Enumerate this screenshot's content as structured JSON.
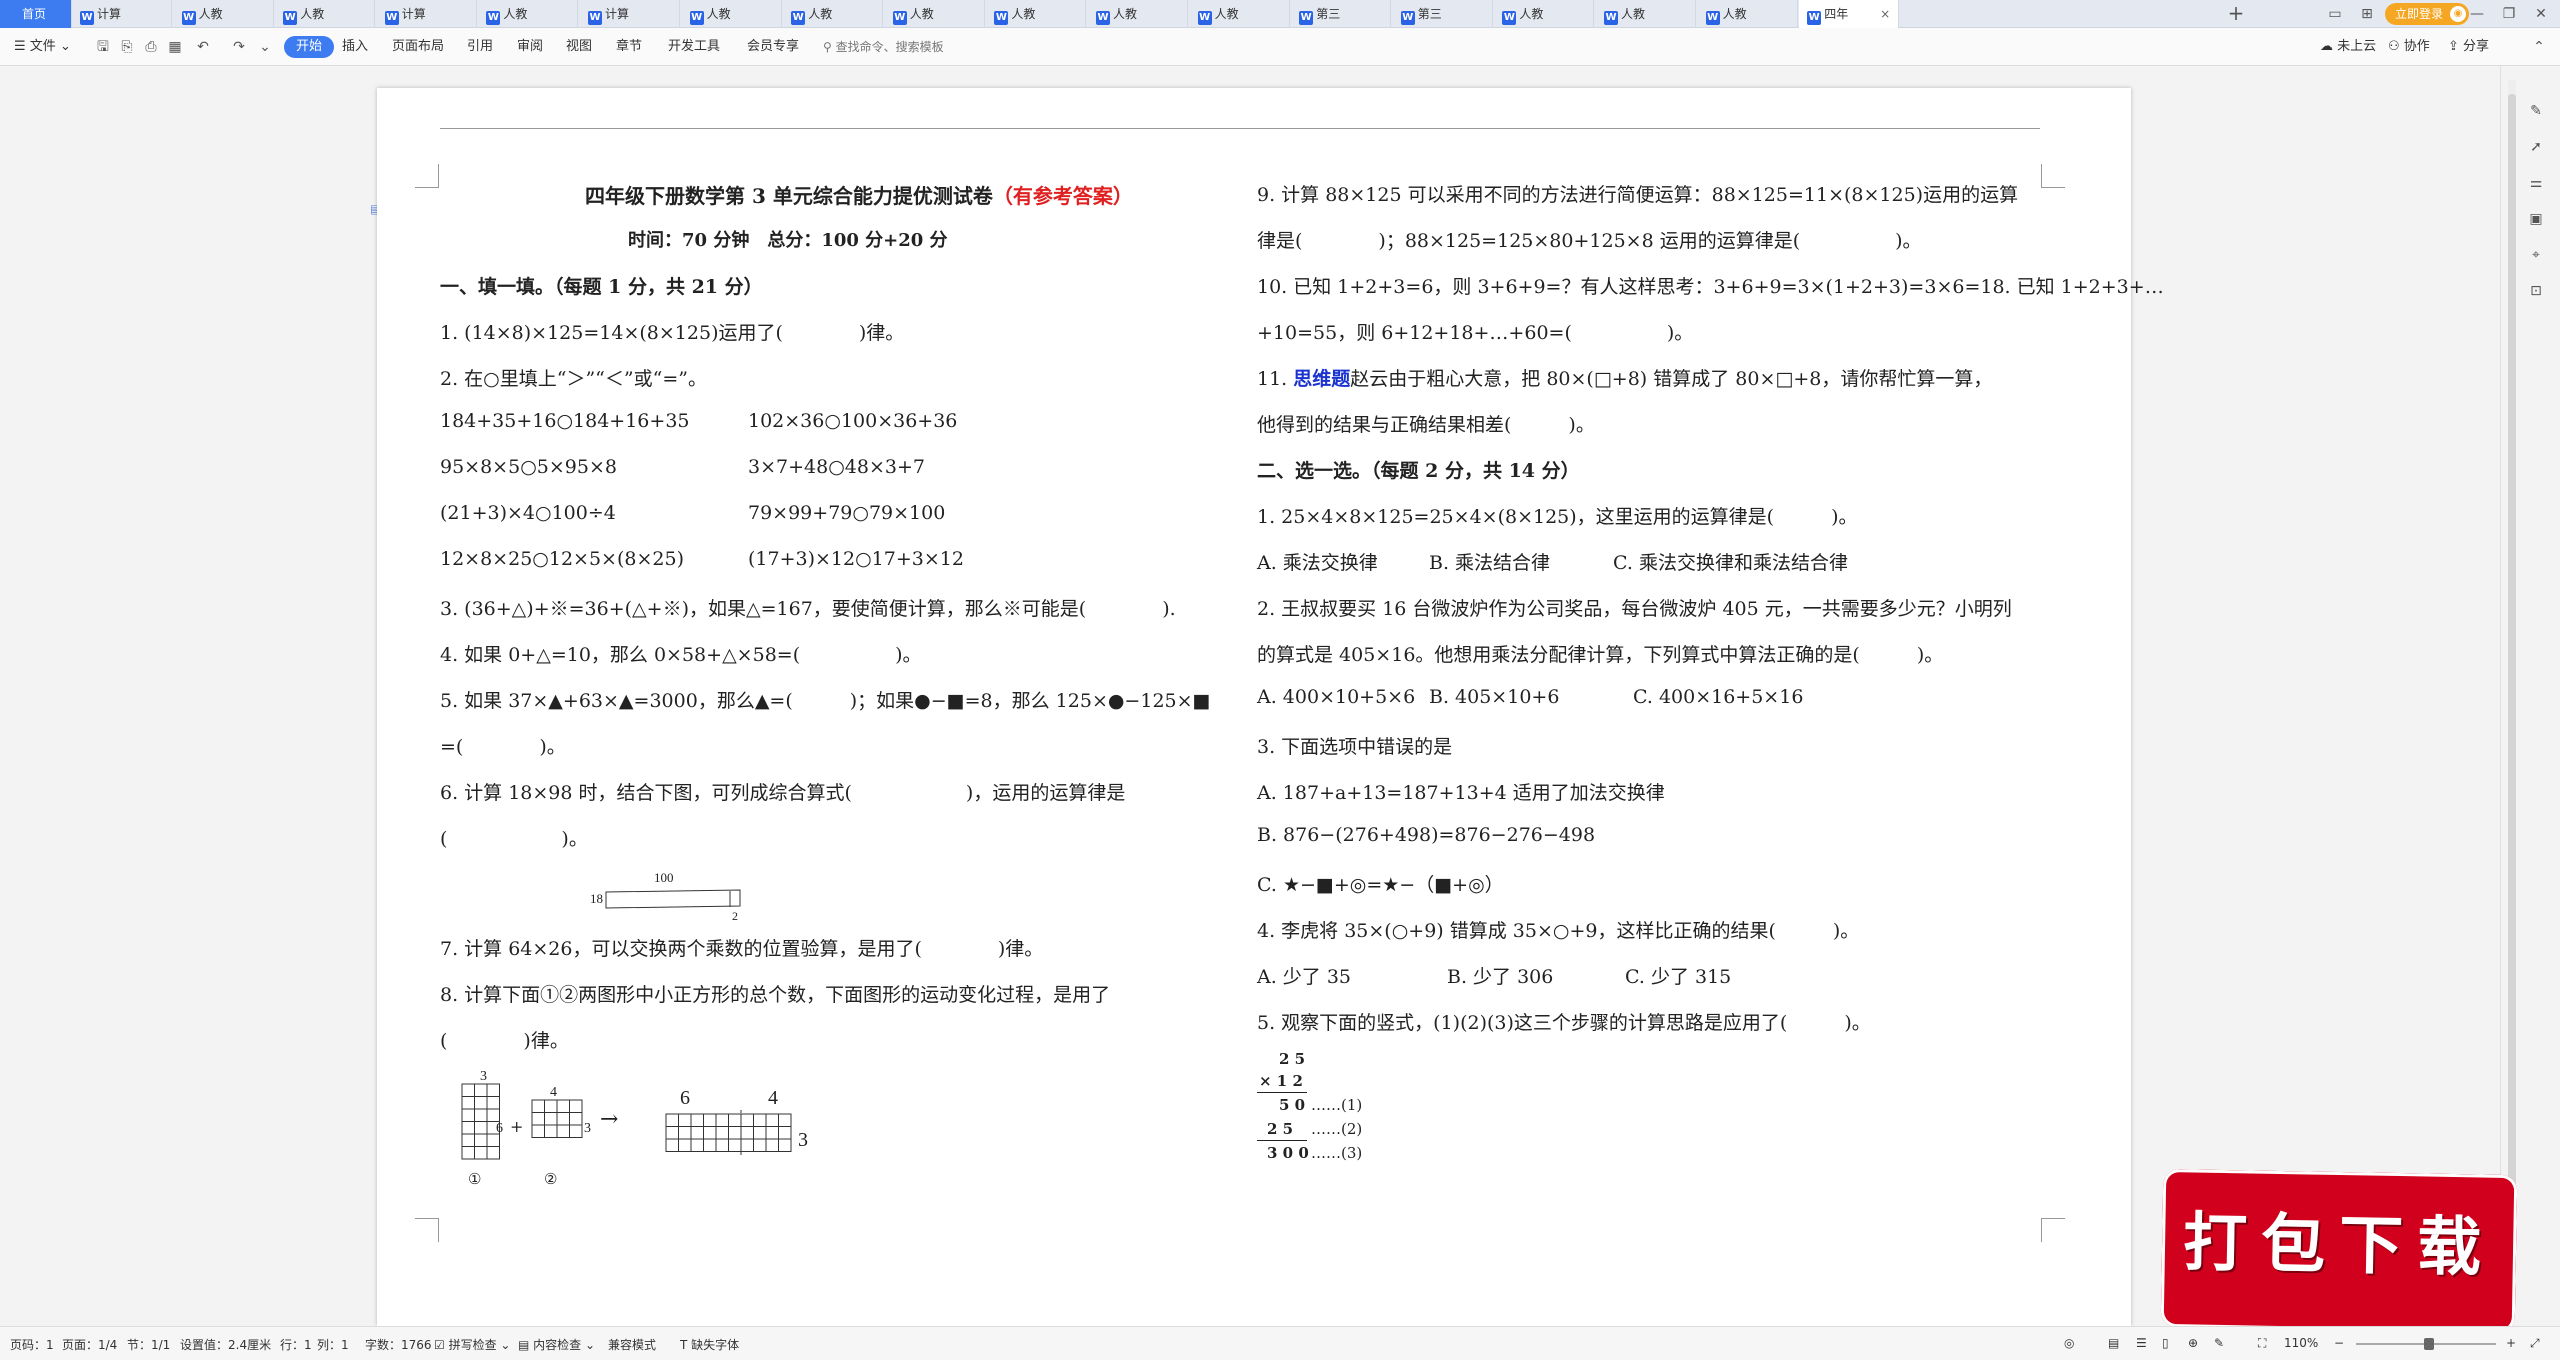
{
  "tabs": {
    "home": "首页",
    "items": [
      "计算",
      "人教",
      "人教",
      "计算",
      "人教",
      "计算",
      "人教",
      "人教",
      "人教",
      "人教",
      "人教",
      "人教",
      "第三",
      "第三",
      "人教",
      "人教",
      "人教",
      "四年"
    ],
    "active": "四年"
  },
  "titlebar": {
    "login": "立即登录"
  },
  "menu": {
    "file": "文件",
    "start": "开始",
    "insert": "插入",
    "layout": "页面布局",
    "reference": "引用",
    "review": "审阅",
    "view": "视图",
    "section": "章节",
    "dev": "开发工具",
    "member": "会员专享",
    "search": "查找命令、搜索模板",
    "cloud": "未上云",
    "collab": "协作",
    "share": "分享"
  },
  "doc": {
    "title": "四年级下册数学第 3 单元综合能力提优测试卷",
    "title_red": "（有参考答案）",
    "time": "时间：70 分钟　总分：100 分+20 分",
    "s1": "一、填一填。（每题 1 分，共 21 分）",
    "q1": "1. (14×8)×125=14×(8×125)运用了(　　　　)律。",
    "q2": "2. 在○里填上“＞”“＜”或“=”。",
    "q2a": "184+35+16○184+16+35",
    "q2b": "102×36○100×36+36",
    "q2c": "95×8×5○5×95×8",
    "q2d": "3×7+48○48×3+7",
    "q2e": "(21+3)×4○100÷4",
    "q2f": "79×99+79○79×100",
    "q2g": "12×8×25○12×5×(8×25)",
    "q2h": "(17+3)×12○17+3×12",
    "q3": "3. (36+△)+※=36+(△+※)，如果△=167，要使简便计算，那么※可能是(　　　　).",
    "q4": "4. 如果 0+△=10，那么 0×58+△×58=(　　　　　)。",
    "q5": "5. 如果 37×▲+63×▲=3000，那么▲=(　　　)；如果●−■=8，那么 125×●−125×■",
    "q5b": "=(　　　　)。",
    "q6": "6. 计算 18×98 时，结合下图，可列成综合算式(　　　　　　)，运用的运算律是",
    "q6b": "(　　　　　　)。",
    "fig6_top": "100",
    "fig6_left": "18",
    "fig6_right": "2",
    "q7": "7. 计算 64×26，可以交换两个乘数的位置验算，是用了(　　　　)律。",
    "q8": "8. 计算下面①②两图形中小正方形的总个数，下面图形的运动变化过程，是用了",
    "q8b": "(　　　　)律。",
    "fig8": {
      "a_top": "3",
      "a_right": "6",
      "plus": "+",
      "b_top": "4",
      "b_right": "3",
      "arrow": "→",
      "c_left": "6",
      "c_right": "4",
      "c_side": "3",
      "lab1": "①",
      "lab2": "②"
    },
    "q9": "9. 计算 88×125 可以采用不同的方法进行简便运算：88×125=11×(8×125)运用的运算",
    "q9b": "律是(　　　　)；88×125=125×80+125×8 运用的运算律是(　　　　　)。",
    "q10": "10. 已知 1+2+3=6，则 3+6+9=？有人这样思考：3+6+9=3×(1+2+3)=3×6=18. 已知 1+2+3+…",
    "q10b": "+10=55，则 6+12+18+…+60=(　　　　　)。",
    "q11_pre": "11. ",
    "q11_tag": "思维题",
    "q11": "赵云由于粗心大意，把 80×(□+8) 错算成了 80×□+8，请你帮忙算一算，",
    "q11b": "他得到的结果与正确结果相差(　　　)。",
    "s2": "二、选一选。（每题 2 分，共 14 分）",
    "c1": "1. 25×4×8×125=25×4×(8×125)，这里运用的运算律是(　　　)。",
    "c1a": "A. 乘法交换律",
    "c1b": "B. 乘法结合律",
    "c1c": "C. 乘法交换律和乘法结合律",
    "c2": "2. 王叔叔要买 16 台微波炉作为公司奖品，每台微波炉 405 元，一共需要多少元？小明列",
    "c2b": "的算式是 405×16。他想用乘法分配律计算，下列算式中算法正确的是(　　　)。",
    "c2a": "A. 400×10+5×6",
    "c2bb": "B. 405×10+6",
    "c2c": "C. 400×16+5×16",
    "c3": "3. 下面选项中错误的是",
    "c3a": "A. 187+a+13=187+13+4  适用了加法交换律",
    "c3b": "B. 876−(276+498)=876−276−498",
    "c3c": "C. ★−■+◎=★−（■+◎）",
    "c4": "4. 李虎将 35×(○+9) 错算成 35×○+9，这样比正确的结果(　　　)。",
    "c4a": "A. 少了 35",
    "c4b": "B. 少了 306",
    "c4c": "C. 少了 315",
    "c5": "5. 观察下面的竖式，(1)(2)(3)这三个步骤的计算思路是应用了(　　　)。",
    "v1": "2 5",
    "v2": "× 1 2",
    "v3": "5 0",
    "v3n": "……(1)",
    "v4": "2 5",
    "v4n": "……(2)",
    "v5": "3 0 0",
    "v5n": "……(3)"
  },
  "watermark": "打包下载",
  "status": {
    "page_no": "页码：1",
    "pages": "页面：1/4",
    "section": "节：1/1",
    "setting": "设置值：2.4厘米",
    "row": "行：1",
    "col": "列：1",
    "words": "字数：1766",
    "spell": "拼写检查",
    "content": "内容检查",
    "compat": "兼容模式",
    "font": "缺失字体",
    "zoom": "110%"
  }
}
